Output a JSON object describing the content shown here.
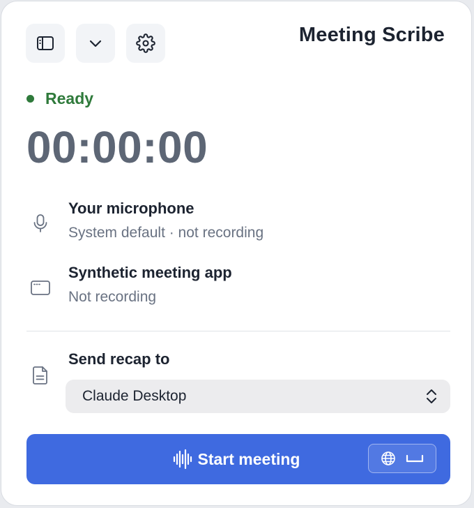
{
  "app": {
    "title": "Meeting Scribe"
  },
  "toolbar": {
    "buttons": [
      {
        "name": "sidebar-toggle",
        "icon": "sidebar-icon"
      },
      {
        "name": "collapse",
        "icon": "chevron-down-icon"
      },
      {
        "name": "settings",
        "icon": "gear-icon"
      }
    ]
  },
  "status": {
    "text": "Ready",
    "color": "#2f7a3b"
  },
  "timer": {
    "value": "00:00:00"
  },
  "sources": [
    {
      "icon": "microphone-icon",
      "title": "Your microphone",
      "subtitle": "System default · not recording"
    },
    {
      "icon": "window-icon",
      "title": "Synthetic meeting app",
      "subtitle": "Not recording"
    }
  ],
  "recap": {
    "label": "Send recap to",
    "icon": "document-icon",
    "selected": "Claude Desktop"
  },
  "start_button": {
    "label": "Start meeting",
    "icon": "waveform-icon",
    "shortcut_icons": [
      "globe-icon",
      "space-key-icon"
    ]
  },
  "colors": {
    "accent": "#3f6ae0",
    "ready": "#2f7a3b",
    "text_primary": "#1c2330",
    "text_secondary": "#697282"
  }
}
